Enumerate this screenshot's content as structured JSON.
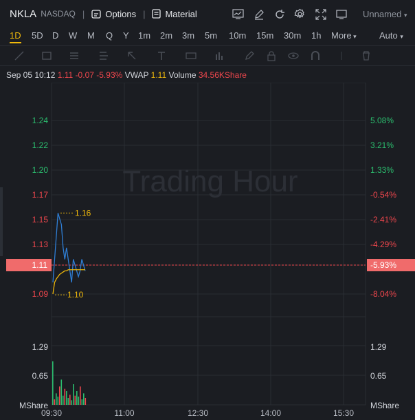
{
  "header": {
    "symbol": "NKLA",
    "exchange": "NASDAQ",
    "options_label": "Options",
    "material_label": "Material",
    "layout_name": "Unnamed",
    "tool_icons": [
      "chart-icon",
      "edit-icon",
      "refresh-icon",
      "settings-icon",
      "fullscreen-icon",
      "screen-icon"
    ]
  },
  "periods": {
    "items": [
      "1D",
      "5D",
      "D",
      "W",
      "M",
      "Q",
      "Y",
      "1m",
      "2m",
      "3m",
      "5m",
      "10m",
      "15m",
      "30m",
      "1h",
      "More"
    ],
    "active": "1D",
    "scale": "Auto"
  },
  "quote": {
    "datetime": "Sep 05 10:12",
    "price": "1.11",
    "change": "-0.07",
    "change_pct": "-5.93%",
    "vwap_label": "VWAP",
    "vwap": "1.11",
    "volume_label": "Volume",
    "volume": "34.56KShare"
  },
  "chart": {
    "watermark": "Trading Hour",
    "price_labels": [
      "1.24",
      "1.22",
      "1.20",
      "1.17",
      "1.15",
      "1.13",
      "1.11",
      "1.09"
    ],
    "pct_labels": [
      "5.08%",
      "3.21%",
      "1.33%",
      "-0.54%",
      "-2.41%",
      "-4.29%",
      "-5.93%",
      "-8.04%"
    ],
    "current_price": "1.11",
    "current_pct": "-5.93%",
    "high_marker": "1.16",
    "low_marker": "1.10",
    "volume_labels": [
      "1.29",
      "0.65",
      "MShare"
    ],
    "time_labels": [
      "09:30",
      "11:00",
      "12:30",
      "14:00",
      "15:30"
    ],
    "colors": {
      "up": "#2bbd6e",
      "down": "#f0474d",
      "price_line": "#2f7fd6",
      "vwap_line": "#f0b90b",
      "grid": "#2a2d33"
    }
  },
  "chart_data": {
    "type": "line",
    "title": "",
    "x_ticks": [
      "09:30",
      "11:00",
      "12:30",
      "14:00",
      "15:30"
    ],
    "ylim": [
      1.09,
      1.24
    ],
    "series": [
      {
        "values": [
          1.1,
          1.12,
          1.14,
          1.16,
          1.155,
          1.15,
          1.13,
          1.12,
          1.13,
          1.12,
          1.11,
          1.1,
          1.12,
          1.115,
          1.11,
          1.105,
          1.11,
          1.12,
          1.115,
          1.11
        ]
      },
      {
        "values": [
          1.09,
          1.1,
          1.103,
          1.105,
          1.107,
          1.108,
          1.109,
          1.11,
          1.11,
          1.111,
          1.111,
          1.111,
          1.111,
          1.111,
          1.111,
          1.111,
          1.111,
          1.111,
          1.111,
          1.111
        ]
      }
    ],
    "volume_ylim": [
      0,
      1.29
    ],
    "volume": [
      0.95,
      0.12,
      0.25,
      0.18,
      0.4,
      0.55,
      0.2,
      0.35,
      0.3,
      0.15,
      0.22,
      0.1,
      0.45,
      0.2,
      0.3,
      0.18,
      0.4,
      0.12,
      0.25,
      0.15
    ]
  }
}
